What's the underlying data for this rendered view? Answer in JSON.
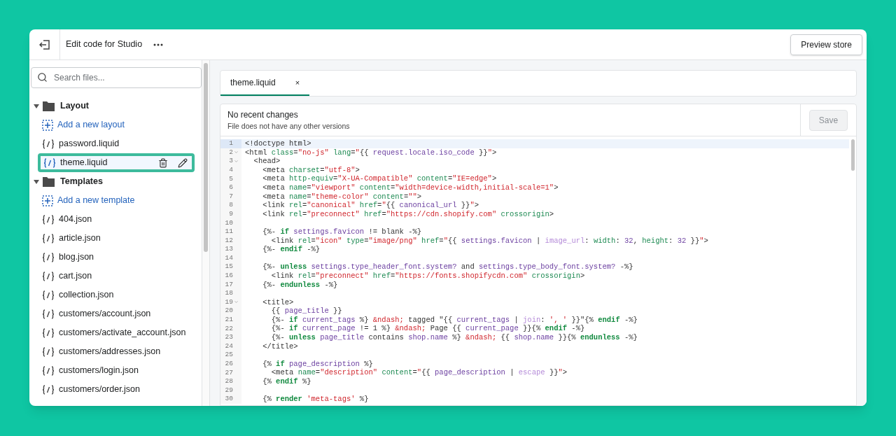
{
  "header": {
    "title": "Edit code for Studio",
    "preview_button": "Preview store"
  },
  "sidebar": {
    "search": {
      "placeholder": "Search files..."
    },
    "folders": [
      {
        "name": "Layout",
        "expanded": true,
        "children": [
          {
            "kind": "add",
            "name": "Add a new layout",
            "selected": false
          },
          {
            "kind": "file",
            "name": "password.liquid",
            "selected": false
          },
          {
            "kind": "file",
            "name": "theme.liquid",
            "selected": true
          }
        ]
      },
      {
        "name": "Templates",
        "expanded": true,
        "children": [
          {
            "kind": "add",
            "name": "Add a new template",
            "selected": false
          },
          {
            "kind": "file",
            "name": "404.json",
            "selected": false
          },
          {
            "kind": "file",
            "name": "article.json",
            "selected": false
          },
          {
            "kind": "file",
            "name": "blog.json",
            "selected": false
          },
          {
            "kind": "file",
            "name": "cart.json",
            "selected": false
          },
          {
            "kind": "file",
            "name": "collection.json",
            "selected": false
          },
          {
            "kind": "file",
            "name": "customers/account.json",
            "selected": false
          },
          {
            "kind": "file",
            "name": "customers/activate_account.json",
            "selected": false
          },
          {
            "kind": "file",
            "name": "customers/addresses.json",
            "selected": false
          },
          {
            "kind": "file",
            "name": "customers/login.json",
            "selected": false
          },
          {
            "kind": "file",
            "name": "customers/order.json",
            "selected": false
          }
        ]
      }
    ]
  },
  "tabs": [
    {
      "label": "theme.liquid",
      "close": "×",
      "selected": true
    }
  ],
  "status": {
    "title": "No recent changes",
    "subtitle": "File does not have any other versions",
    "save_button": "Save",
    "save_disabled": true
  },
  "code": [
    {
      "n": "1",
      "fold": false,
      "active": true,
      "seg": [
        {
          "kind": "text",
          "text": "<!doctype html>"
        }
      ]
    },
    {
      "n": "2",
      "fold": true,
      "active": false,
      "seg": [
        {
          "kind": "text",
          "text": "<html "
        },
        {
          "kind": "attr",
          "text": "class"
        },
        {
          "kind": "text",
          "text": "="
        },
        {
          "kind": "str",
          "text": "\"no-js\""
        },
        {
          "kind": "attr",
          "text": " lang"
        },
        {
          "kind": "text",
          "text": "="
        },
        {
          "kind": "str",
          "text": "\""
        },
        {
          "kind": "text",
          "text": "{{ "
        },
        {
          "kind": "var",
          "text": "request.locale.iso_code"
        },
        {
          "kind": "text",
          "text": " }}"
        },
        {
          "kind": "str",
          "text": "\""
        },
        {
          "kind": "text",
          "text": ">"
        }
      ]
    },
    {
      "n": "3",
      "fold": true,
      "active": false,
      "seg": [
        {
          "kind": "text",
          "text": "  <head>"
        }
      ]
    },
    {
      "n": "4",
      "fold": false,
      "active": false,
      "seg": [
        {
          "kind": "text",
          "text": "    <meta "
        },
        {
          "kind": "attr",
          "text": "charset"
        },
        {
          "kind": "text",
          "text": "="
        },
        {
          "kind": "str",
          "text": "\"utf-8\""
        },
        {
          "kind": "text",
          "text": ">"
        }
      ]
    },
    {
      "n": "5",
      "fold": false,
      "active": false,
      "seg": [
        {
          "kind": "text",
          "text": "    <meta "
        },
        {
          "kind": "attr",
          "text": "http-equiv"
        },
        {
          "kind": "text",
          "text": "="
        },
        {
          "kind": "str",
          "text": "\"X-UA-Compatible\""
        },
        {
          "kind": "attr",
          "text": " content"
        },
        {
          "kind": "text",
          "text": "="
        },
        {
          "kind": "str",
          "text": "\"IE=edge\""
        },
        {
          "kind": "text",
          "text": ">"
        }
      ]
    },
    {
      "n": "6",
      "fold": false,
      "active": false,
      "seg": [
        {
          "kind": "text",
          "text": "    <meta "
        },
        {
          "kind": "attr",
          "text": "name"
        },
        {
          "kind": "text",
          "text": "="
        },
        {
          "kind": "str",
          "text": "\"viewport\""
        },
        {
          "kind": "attr",
          "text": " content"
        },
        {
          "kind": "text",
          "text": "="
        },
        {
          "kind": "str",
          "text": "\"width=device-width,initial-scale=1\""
        },
        {
          "kind": "text",
          "text": ">"
        }
      ]
    },
    {
      "n": "7",
      "fold": false,
      "active": false,
      "seg": [
        {
          "kind": "text",
          "text": "    <meta "
        },
        {
          "kind": "attr",
          "text": "name"
        },
        {
          "kind": "text",
          "text": "="
        },
        {
          "kind": "str",
          "text": "\"theme-color\""
        },
        {
          "kind": "attr",
          "text": " content"
        },
        {
          "kind": "text",
          "text": "="
        },
        {
          "kind": "str",
          "text": "\"\""
        },
        {
          "kind": "text",
          "text": ">"
        }
      ]
    },
    {
      "n": "8",
      "fold": false,
      "active": false,
      "seg": [
        {
          "kind": "text",
          "text": "    <link "
        },
        {
          "kind": "attr",
          "text": "rel"
        },
        {
          "kind": "text",
          "text": "="
        },
        {
          "kind": "str",
          "text": "\"canonical\""
        },
        {
          "kind": "attr",
          "text": " href"
        },
        {
          "kind": "text",
          "text": "="
        },
        {
          "kind": "str",
          "text": "\""
        },
        {
          "kind": "text",
          "text": "{{ "
        },
        {
          "kind": "var",
          "text": "canonical_url"
        },
        {
          "kind": "text",
          "text": " }}"
        },
        {
          "kind": "str",
          "text": "\""
        },
        {
          "kind": "text",
          "text": ">"
        }
      ]
    },
    {
      "n": "9",
      "fold": false,
      "active": false,
      "seg": [
        {
          "kind": "text",
          "text": "    <link "
        },
        {
          "kind": "attr",
          "text": "rel"
        },
        {
          "kind": "text",
          "text": "="
        },
        {
          "kind": "str",
          "text": "\"preconnect\""
        },
        {
          "kind": "attr",
          "text": " href"
        },
        {
          "kind": "text",
          "text": "="
        },
        {
          "kind": "str",
          "text": "\"https://cdn.shopify.com\""
        },
        {
          "kind": "attr",
          "text": " crossorigin"
        },
        {
          "kind": "text",
          "text": ">"
        }
      ]
    },
    {
      "n": "10",
      "fold": false,
      "active": false
    },
    {
      "n": "11",
      "fold": false,
      "active": false,
      "seg": [
        {
          "kind": "text",
          "text": "    {%- "
        },
        {
          "kind": "kw",
          "text": "if"
        },
        {
          "kind": "var",
          "text": " settings.favicon"
        },
        {
          "kind": "text",
          "text": " != blank -%}"
        }
      ]
    },
    {
      "n": "12",
      "fold": false,
      "active": false,
      "seg": [
        {
          "kind": "text",
          "text": "      <link "
        },
        {
          "kind": "attr",
          "text": "rel"
        },
        {
          "kind": "text",
          "text": "="
        },
        {
          "kind": "str",
          "text": "\"icon\""
        },
        {
          "kind": "attr",
          "text": " type"
        },
        {
          "kind": "text",
          "text": "="
        },
        {
          "kind": "str",
          "text": "\"image/png\""
        },
        {
          "kind": "attr",
          "text": " href"
        },
        {
          "kind": "text",
          "text": "="
        },
        {
          "kind": "str",
          "text": "\""
        },
        {
          "kind": "text",
          "text": "{{ "
        },
        {
          "kind": "var",
          "text": "settings.favicon"
        },
        {
          "kind": "text",
          "text": " | "
        },
        {
          "kind": "filter",
          "text": "image_url"
        },
        {
          "kind": "text",
          "text": ": "
        },
        {
          "kind": "attr",
          "text": "width"
        },
        {
          "kind": "text",
          "text": ": "
        },
        {
          "kind": "var",
          "text": "32"
        },
        {
          "kind": "text",
          "text": ", "
        },
        {
          "kind": "attr",
          "text": "height"
        },
        {
          "kind": "text",
          "text": ": "
        },
        {
          "kind": "var",
          "text": "32"
        },
        {
          "kind": "text",
          "text": " }}"
        },
        {
          "kind": "str",
          "text": "\""
        },
        {
          "kind": "text",
          "text": ">"
        }
      ]
    },
    {
      "n": "13",
      "fold": false,
      "active": false,
      "seg": [
        {
          "kind": "text",
          "text": "    {%- "
        },
        {
          "kind": "kw",
          "text": "endif"
        },
        {
          "kind": "text",
          "text": " -%}"
        }
      ]
    },
    {
      "n": "14",
      "fold": false,
      "active": false
    },
    {
      "n": "15",
      "fold": false,
      "active": false,
      "seg": [
        {
          "kind": "text",
          "text": "    {%- "
        },
        {
          "kind": "kw",
          "text": "unless"
        },
        {
          "kind": "var",
          "text": " settings.type_header_font.system?"
        },
        {
          "kind": "text",
          "text": " and "
        },
        {
          "kind": "var",
          "text": "settings.type_body_font.system?"
        },
        {
          "kind": "text",
          "text": " -%}"
        }
      ]
    },
    {
      "n": "16",
      "fold": false,
      "active": false,
      "seg": [
        {
          "kind": "text",
          "text": "      <link "
        },
        {
          "kind": "attr",
          "text": "rel"
        },
        {
          "kind": "text",
          "text": "="
        },
        {
          "kind": "str",
          "text": "\"preconnect\""
        },
        {
          "kind": "attr",
          "text": " href"
        },
        {
          "kind": "text",
          "text": "="
        },
        {
          "kind": "str",
          "text": "\"https://fonts.shopifycdn.com\""
        },
        {
          "kind": "attr",
          "text": " crossorigin"
        },
        {
          "kind": "text",
          "text": ">"
        }
      ]
    },
    {
      "n": "17",
      "fold": false,
      "active": false,
      "seg": [
        {
          "kind": "text",
          "text": "    {%- "
        },
        {
          "kind": "kw",
          "text": "endunless"
        },
        {
          "kind": "text",
          "text": " -%}"
        }
      ]
    },
    {
      "n": "18",
      "fold": false,
      "active": false
    },
    {
      "n": "19",
      "fold": true,
      "active": false,
      "seg": [
        {
          "kind": "text",
          "text": "    <title>"
        }
      ]
    },
    {
      "n": "20",
      "fold": false,
      "active": false,
      "seg": [
        {
          "kind": "text",
          "text": "      {{ "
        },
        {
          "kind": "var",
          "text": "page_title"
        },
        {
          "kind": "text",
          "text": " }}"
        }
      ]
    },
    {
      "n": "21",
      "fold": false,
      "active": false,
      "seg": [
        {
          "kind": "text",
          "text": "      {%- "
        },
        {
          "kind": "kw",
          "text": "if"
        },
        {
          "kind": "var",
          "text": " current_tags"
        },
        {
          "kind": "text",
          "text": " %} "
        },
        {
          "kind": "str",
          "text": "&ndash;"
        },
        {
          "kind": "text",
          "text": " tagged \"{{ "
        },
        {
          "kind": "var",
          "text": "current_tags"
        },
        {
          "kind": "text",
          "text": " | "
        },
        {
          "kind": "filter",
          "text": "join"
        },
        {
          "kind": "text",
          "text": ": "
        },
        {
          "kind": "str",
          "text": "', '"
        },
        {
          "kind": "text",
          "text": " }}\"{% "
        },
        {
          "kind": "kw",
          "text": "endif"
        },
        {
          "kind": "text",
          "text": " -%}"
        }
      ]
    },
    {
      "n": "22",
      "fold": false,
      "active": false,
      "seg": [
        {
          "kind": "text",
          "text": "      {%- "
        },
        {
          "kind": "kw",
          "text": "if"
        },
        {
          "kind": "var",
          "text": " current_page"
        },
        {
          "kind": "text",
          "text": " != 1 %} "
        },
        {
          "kind": "str",
          "text": "&ndash;"
        },
        {
          "kind": "text",
          "text": " Page {{ "
        },
        {
          "kind": "var",
          "text": "current_page"
        },
        {
          "kind": "text",
          "text": " }}{% "
        },
        {
          "kind": "kw",
          "text": "endif"
        },
        {
          "kind": "text",
          "text": " -%}"
        }
      ]
    },
    {
      "n": "23",
      "fold": false,
      "active": false,
      "seg": [
        {
          "kind": "text",
          "text": "      {%- "
        },
        {
          "kind": "kw",
          "text": "unless"
        },
        {
          "kind": "var",
          "text": " page_title"
        },
        {
          "kind": "text",
          "text": " contains "
        },
        {
          "kind": "var",
          "text": "shop.name"
        },
        {
          "kind": "text",
          "text": " %} "
        },
        {
          "kind": "str",
          "text": "&ndash;"
        },
        {
          "kind": "text",
          "text": " {{ "
        },
        {
          "kind": "var",
          "text": "shop.name"
        },
        {
          "kind": "text",
          "text": " }}{% "
        },
        {
          "kind": "kw",
          "text": "endunless"
        },
        {
          "kind": "text",
          "text": " -%}"
        }
      ]
    },
    {
      "n": "24",
      "fold": false,
      "active": false,
      "seg": [
        {
          "kind": "text",
          "text": "    </title>"
        }
      ]
    },
    {
      "n": "25",
      "fold": false,
      "active": false
    },
    {
      "n": "26",
      "fold": false,
      "active": false,
      "seg": [
        {
          "kind": "text",
          "text": "    {% "
        },
        {
          "kind": "kw",
          "text": "if"
        },
        {
          "kind": "var",
          "text": " page_description"
        },
        {
          "kind": "text",
          "text": " %}"
        }
      ]
    },
    {
      "n": "27",
      "fold": false,
      "active": false,
      "seg": [
        {
          "kind": "text",
          "text": "      <meta "
        },
        {
          "kind": "attr",
          "text": "name"
        },
        {
          "kind": "text",
          "text": "="
        },
        {
          "kind": "str",
          "text": "\"description\""
        },
        {
          "kind": "attr",
          "text": " content"
        },
        {
          "kind": "text",
          "text": "="
        },
        {
          "kind": "str",
          "text": "\""
        },
        {
          "kind": "text",
          "text": "{{ "
        },
        {
          "kind": "var",
          "text": "page_description"
        },
        {
          "kind": "text",
          "text": " | "
        },
        {
          "kind": "filter",
          "text": "escape"
        },
        {
          "kind": "text",
          "text": " }}"
        },
        {
          "kind": "str",
          "text": "\""
        },
        {
          "kind": "text",
          "text": ">"
        }
      ]
    },
    {
      "n": "28",
      "fold": false,
      "active": false,
      "seg": [
        {
          "kind": "text",
          "text": "    {% "
        },
        {
          "kind": "kw",
          "text": "endif"
        },
        {
          "kind": "text",
          "text": " %}"
        }
      ]
    },
    {
      "n": "29",
      "fold": false,
      "active": false
    },
    {
      "n": "30",
      "fold": false,
      "active": false,
      "seg": [
        {
          "kind": "text",
          "text": "    {% "
        },
        {
          "kind": "kw",
          "text": "render"
        },
        {
          "kind": "str",
          "text": " 'meta-tags'"
        },
        {
          "kind": "text",
          "text": " %}"
        }
      ]
    }
  ]
}
